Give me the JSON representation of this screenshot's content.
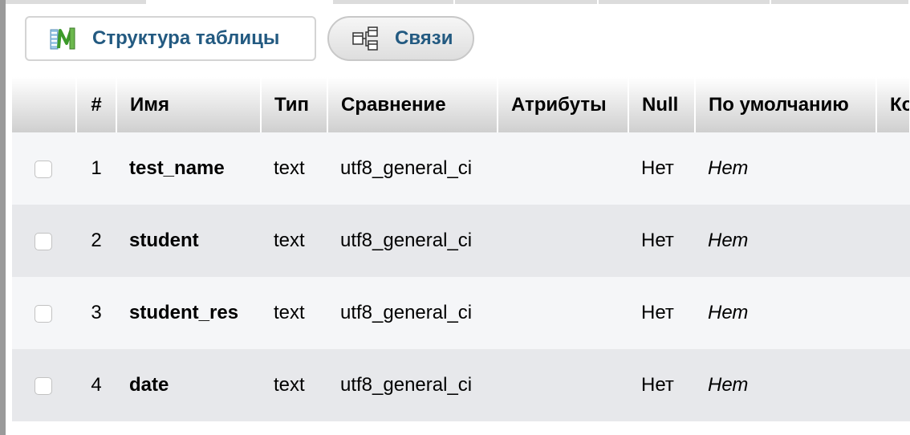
{
  "subtabs": {
    "structure": {
      "label": "Структура таблицы",
      "icon": "table-structure-icon"
    },
    "relations": {
      "label": "Связи",
      "icon": "relations-icon"
    }
  },
  "table": {
    "headers": {
      "num": "#",
      "name": "Имя",
      "type": "Тип",
      "collation": "Сравнение",
      "attributes": "Атрибуты",
      "null": "Null",
      "default": "По умолчанию",
      "comments": "Ко"
    },
    "rows": [
      {
        "num": "1",
        "name": "test_name",
        "type": "text",
        "collation": "utf8_general_ci",
        "attributes": "",
        "null": "Нет",
        "default": "Нет",
        "comments": ""
      },
      {
        "num": "2",
        "name": "student",
        "type": "text",
        "collation": "utf8_general_ci",
        "attributes": "",
        "null": "Нет",
        "default": "Нет",
        "comments": ""
      },
      {
        "num": "3",
        "name": "student_res",
        "type": "text",
        "collation": "utf8_general_ci",
        "attributes": "",
        "null": "Нет",
        "default": "Нет",
        "comments": ""
      },
      {
        "num": "4",
        "name": "date",
        "type": "text",
        "collation": "utf8_general_ci",
        "attributes": "",
        "null": "Нет",
        "default": "Нет",
        "comments": ""
      }
    ]
  },
  "colors": {
    "link": "#235a81",
    "row_odd": "#f5f6f8",
    "row_even": "#e7e8eb"
  }
}
